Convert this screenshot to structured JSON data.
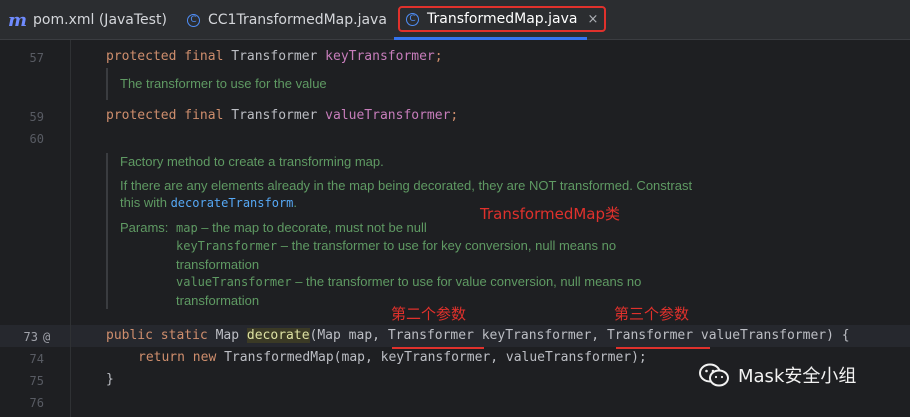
{
  "tabs": [
    {
      "label": "pom.xml (JavaTest)",
      "icon": "maven-icon"
    },
    {
      "label": "CC1TransformedMap.java",
      "icon": "class-icon"
    },
    {
      "label": "TransformedMap.java",
      "icon": "class-icon",
      "active": true
    }
  ],
  "close_glyph": "×",
  "gutter": {
    "lines": [
      "57",
      "59",
      "60",
      "73",
      "74",
      "75",
      "76"
    ],
    "at_marker": "@"
  },
  "code": {
    "line57": {
      "kw1": "protected",
      "kw2": "final",
      "type": "Transformer",
      "field": "keyTransformer",
      "end": ";"
    },
    "doc57": "The transformer to use for the value",
    "line59": {
      "kw1": "protected",
      "kw2": "final",
      "type": "Transformer",
      "field": "valueTransformer",
      "end": ";"
    },
    "doc_decorate": {
      "line1": "Factory method to create a transforming map.",
      "line2": "If there are any elements already in the map being decorated, they are NOT transformed. Constrast",
      "line3_pre": "this with ",
      "line3_link": "decorateTransform",
      "line3_post": ".",
      "params_label": "Params:",
      "p1_name": "map",
      "p1_desc": " – the map to decorate, must not be null",
      "p2_name": "keyTransformer",
      "p2_desc": " – the transformer to use for key conversion, null means no",
      "p2_cont": "transformation",
      "p3_name": "valueTransformer",
      "p3_desc": " – the transformer to use for value conversion, null means no",
      "p3_cont": "transformation"
    },
    "line73": {
      "kw1": "public",
      "kw2": "static",
      "ret": "Map",
      "method": "decorate",
      "p1": "(Map map, ",
      "p2type": "Transformer",
      "p2name": " keyTransformer, ",
      "p3type": "Transformer",
      "p3name": " valueTransformer) {"
    },
    "line74": {
      "kw1": "return",
      "kw2": "new",
      "rest": "TransformedMap(map, keyTransformer, valueTransformer);"
    },
    "line75": "}"
  },
  "annotations": {
    "class_label": "TransformedMap类",
    "second_param": "第二个参数",
    "third_param": "第三个参数"
  },
  "watermark": "Mask安全小组",
  "colors": {
    "annotation": "#e0312c",
    "keyword": "#cf8e6d",
    "field": "#c77dbb",
    "method": "#56a8f5",
    "doc": "#5f9a63"
  }
}
